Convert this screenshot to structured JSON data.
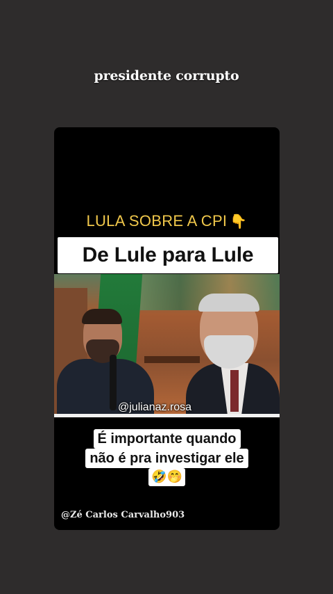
{
  "story": {
    "caption": "presidente corrupto"
  },
  "video": {
    "top_label": "LULA SOBRE A CPI",
    "top_label_emoji": "👇",
    "title": "De Lule para Lule",
    "watermark": "@julianaz.rosa",
    "subtitle_line1": "É importante quando",
    "subtitle_line2": "não é pra investigar ele",
    "subtitle_emojis": "🤣🤭",
    "credit": "@Zé Carlos Carvalho903"
  },
  "colors": {
    "background": "#2e2c2c",
    "card": "#000000",
    "top_label": "#f1c84b",
    "banner": "#ffffff"
  }
}
